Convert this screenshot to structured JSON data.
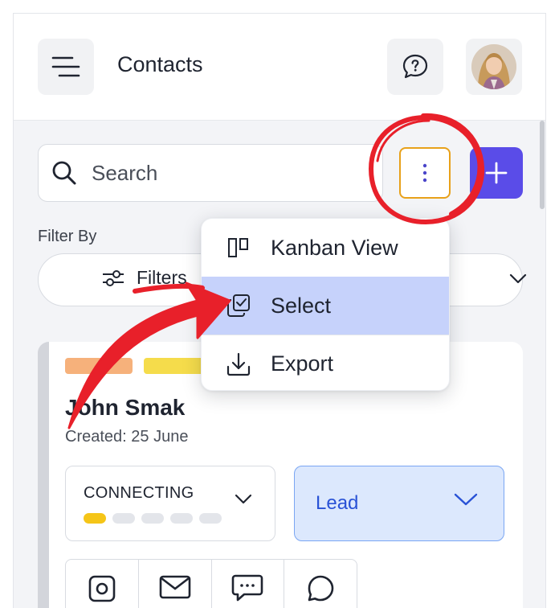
{
  "header": {
    "title": "Contacts"
  },
  "search": {
    "placeholder": "Search"
  },
  "filter": {
    "label": "Filter By",
    "button_label": "Filters"
  },
  "menu": {
    "items": [
      {
        "label": "Kanban View",
        "icon": "kanban-icon"
      },
      {
        "label": "Select",
        "icon": "select-icon",
        "highlighted": true
      },
      {
        "label": "Export",
        "icon": "download-icon"
      }
    ]
  },
  "contact_card": {
    "name": "John Smak",
    "created": "Created: 25 June",
    "status": {
      "label": "CONNECTING",
      "steps_total": 5,
      "steps_done": 1
    },
    "stage": "Lead",
    "tag_colors": [
      "#f6b17b",
      "#f5dc4b"
    ],
    "actions": [
      "instagram-icon",
      "mail-icon",
      "message-icon",
      "whatsapp-icon"
    ]
  },
  "colors": {
    "accent": "#5a4ce8",
    "highlight": "#c6d2fb",
    "annotation_red": "#e8202a",
    "kebab_border": "#e8a11a"
  }
}
